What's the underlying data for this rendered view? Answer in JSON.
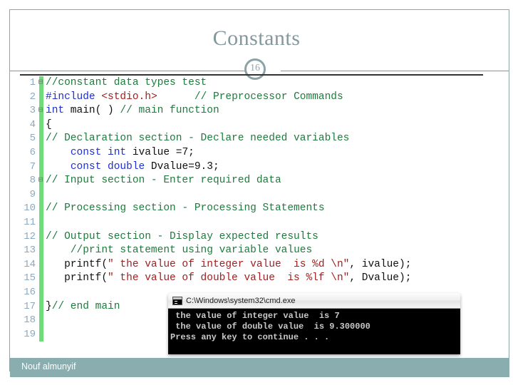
{
  "slide": {
    "title": "Constants",
    "page_number": "16",
    "footer_author": "Nouf almunyif",
    "accent_color": "#8aadb0",
    "title_color": "#84989b",
    "gutter_bar_color": "#6fdc7a"
  },
  "code": {
    "language": "C",
    "lines": [
      {
        "number": "1",
        "fold": "⊟",
        "indent": 0,
        "tokens": [
          {
            "text": "//constant data types test",
            "type": "comment"
          }
        ]
      },
      {
        "number": "2",
        "fold": "",
        "indent": 1,
        "tokens": [
          {
            "text": "#include ",
            "type": "preprocessor"
          },
          {
            "text": "<stdio.h>",
            "type": "include"
          },
          {
            "text": "      ",
            "type": "plain"
          },
          {
            "text": "// Preprocessor Commands",
            "type": "comment"
          }
        ]
      },
      {
        "number": "3",
        "fold": "⊟",
        "indent": 0,
        "tokens": [
          {
            "text": "int",
            "type": "keyword"
          },
          {
            "text": " main( ) ",
            "type": "plain"
          },
          {
            "text": "// main function",
            "type": "comment"
          }
        ]
      },
      {
        "number": "4",
        "fold": "",
        "indent": 1,
        "tokens": [
          {
            "text": "{",
            "type": "plain"
          }
        ]
      },
      {
        "number": "5",
        "fold": "",
        "indent": 1,
        "tokens": [
          {
            "text": "// Declaration section - Declare needed variables",
            "type": "comment"
          }
        ]
      },
      {
        "number": "6",
        "fold": "",
        "indent": 1,
        "tokens": [
          {
            "text": "    ",
            "type": "plain"
          },
          {
            "text": "const int",
            "type": "keyword"
          },
          {
            "text": " ivalue =7;",
            "type": "plain"
          }
        ]
      },
      {
        "number": "7",
        "fold": "",
        "indent": 1,
        "tokens": [
          {
            "text": "    ",
            "type": "plain"
          },
          {
            "text": "const double",
            "type": "keyword"
          },
          {
            "text": " Dvalue=9.3;",
            "type": "plain"
          }
        ]
      },
      {
        "number": "8",
        "fold": "⊟",
        "indent": 0,
        "tokens": [
          {
            "text": "// Input section - Enter required data",
            "type": "comment"
          }
        ]
      },
      {
        "number": "9",
        "fold": "",
        "indent": 1,
        "tokens": [
          {
            "text": "",
            "type": "plain"
          }
        ]
      },
      {
        "number": "10",
        "fold": "",
        "indent": 1,
        "tokens": [
          {
            "text": "// Processing section - Processing Statements",
            "type": "comment"
          }
        ]
      },
      {
        "number": "11",
        "fold": "",
        "indent": 1,
        "tokens": [
          {
            "text": "",
            "type": "plain"
          }
        ]
      },
      {
        "number": "12",
        "fold": "",
        "indent": 1,
        "tokens": [
          {
            "text": "// Output section - Display expected results",
            "type": "comment"
          }
        ]
      },
      {
        "number": "13",
        "fold": "",
        "indent": 1,
        "tokens": [
          {
            "text": "    ",
            "type": "plain"
          },
          {
            "text": "//print statement using variable values",
            "type": "comment"
          }
        ]
      },
      {
        "number": "14",
        "fold": "",
        "indent": 1,
        "tokens": [
          {
            "text": "   printf(",
            "type": "plain"
          },
          {
            "text": "\" the value of integer value  is %d \\n\"",
            "type": "string"
          },
          {
            "text": ", ivalue);",
            "type": "plain"
          }
        ]
      },
      {
        "number": "15",
        "fold": "",
        "indent": 1,
        "tokens": [
          {
            "text": "   printf(",
            "type": "plain"
          },
          {
            "text": "\" the value of double value  is %lf \\n\"",
            "type": "string"
          },
          {
            "text": ", Dvalue);",
            "type": "plain"
          }
        ]
      },
      {
        "number": "16",
        "fold": "",
        "indent": 1,
        "tokens": [
          {
            "text": "",
            "type": "plain"
          }
        ]
      },
      {
        "number": "17",
        "fold": "",
        "indent": 1,
        "tokens": [
          {
            "text": "}",
            "type": "plain"
          },
          {
            "text": "// end main",
            "type": "comment"
          }
        ]
      },
      {
        "number": "18",
        "fold": "",
        "indent": 1,
        "tokens": [
          {
            "text": "",
            "type": "plain"
          }
        ]
      },
      {
        "number": "19",
        "fold": "",
        "indent": 1,
        "tokens": [
          {
            "text": "",
            "type": "plain"
          }
        ]
      }
    ]
  },
  "console": {
    "title": "C:\\Windows\\system32\\cmd.exe",
    "icon": "cmd-icon",
    "output_lines": [
      " the value of integer value  is 7",
      " the value of double value  is 9.300000",
      "Press any key to continue . . ."
    ],
    "background_color": "#000000",
    "text_color": "#c9c9c9"
  }
}
